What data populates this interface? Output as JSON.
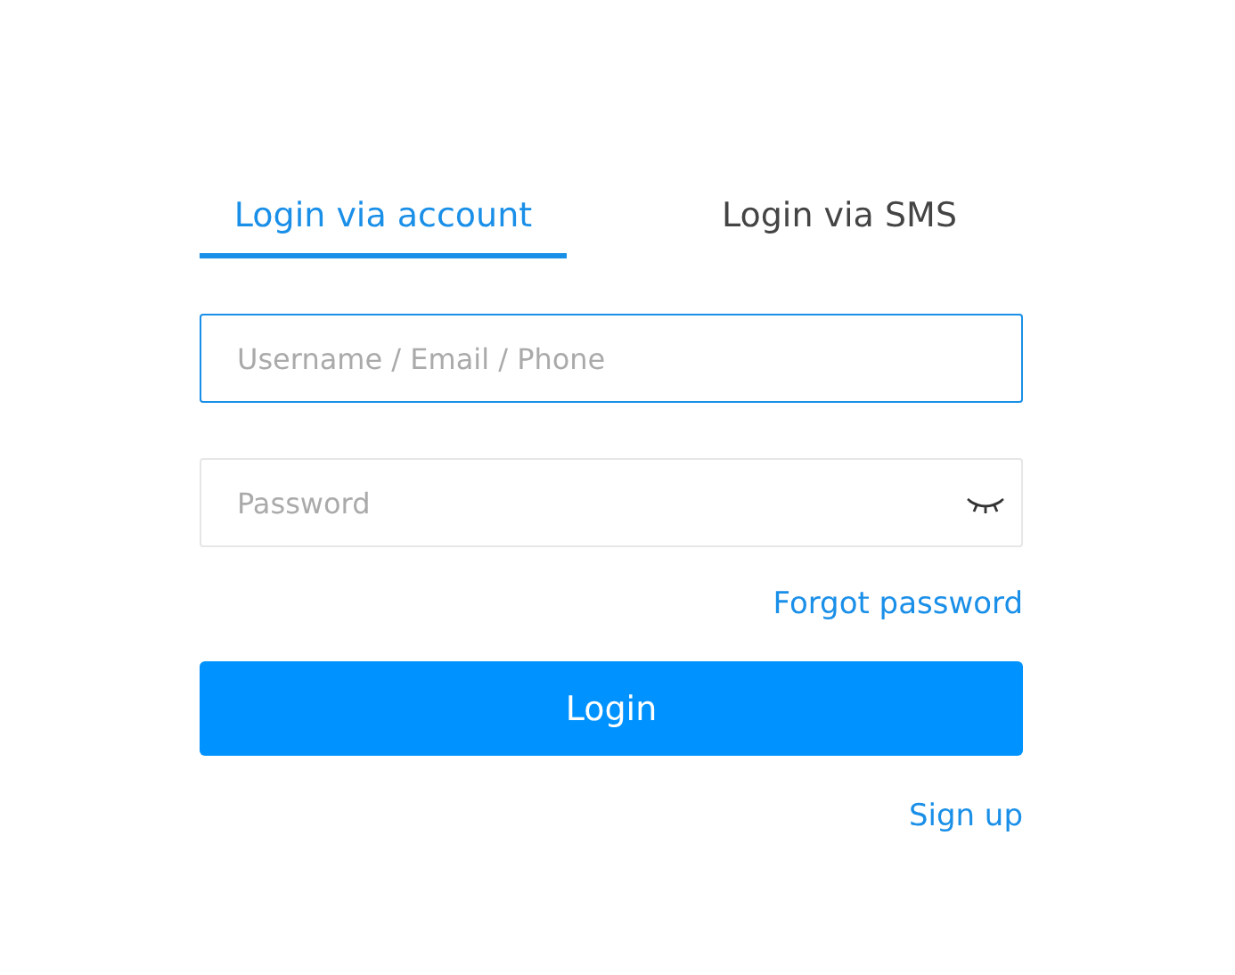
{
  "tabs": [
    {
      "label": "Login via account",
      "selected": true
    },
    {
      "label": "Login via SMS",
      "selected": false
    }
  ],
  "fields": [
    {
      "kind": "text",
      "placeholder": "Username / Email / Phone",
      "focused": true
    },
    {
      "kind": "password",
      "placeholder": "Password",
      "focused": false
    }
  ],
  "forgot_link": "Forgot password",
  "login_button": "Login",
  "signup_link": "Sign up"
}
